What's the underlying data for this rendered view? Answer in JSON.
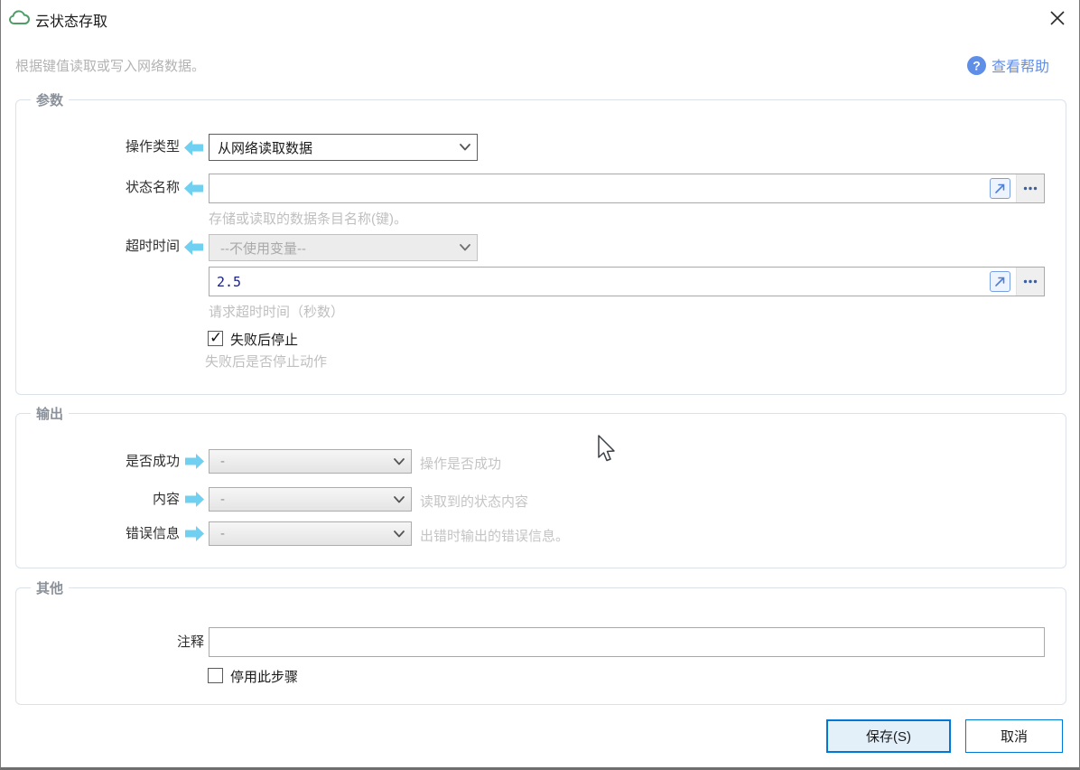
{
  "window": {
    "title": "云状态存取",
    "subtitle": "根据键值读取或写入网络数据。",
    "help_label": "查看帮助"
  },
  "params": {
    "legend": "参数",
    "operation": {
      "label": "操作类型",
      "value": "从网络读取数据"
    },
    "state_name": {
      "label": "状态名称",
      "value": "",
      "hint": "存储或读取的数据条目名称(键)。"
    },
    "timeout": {
      "label": "超时时间",
      "var_select": "--不使用变量--",
      "value": "2.5",
      "hint": "请求超时时间（秒数）"
    },
    "stop_on_fail": {
      "label": "失败后停止",
      "checked": true,
      "hint": "失败后是否停止动作"
    }
  },
  "output": {
    "legend": "输出",
    "rows": [
      {
        "label": "是否成功",
        "value": "-",
        "desc": "操作是否成功"
      },
      {
        "label": "内容",
        "value": "-",
        "desc": "读取到的状态内容"
      },
      {
        "label": "错误信息",
        "value": "-",
        "desc": "出错时输出的错误信息。"
      }
    ]
  },
  "other": {
    "legend": "其他",
    "comment_label": "注释",
    "comment_value": "",
    "disable_label": "停用此步骤",
    "disable_checked": false
  },
  "footer": {
    "save_label": "保存(S)",
    "cancel_label": "取消"
  },
  "colors": {
    "accent_cyan_arrow": "#6fd0f2",
    "help_blue": "#5f8ee9",
    "save_border_blue": "#0078d7",
    "cloud_green": "#4f9e68",
    "mono_value_navy": "#1a237e"
  }
}
